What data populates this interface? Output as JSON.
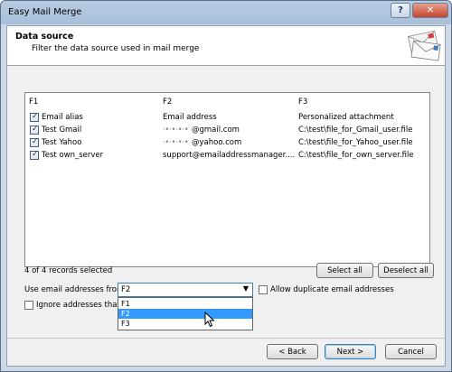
{
  "window": {
    "title": "Easy Mail Merge",
    "help_label": "?",
    "close_label": "✕"
  },
  "header": {
    "title": "Data source",
    "subtitle": "Filter the data source used in mail merge",
    "icon": "envelopes-icon"
  },
  "list": {
    "columns": [
      "F1",
      "F2",
      "F3"
    ],
    "rows": [
      {
        "checked": true,
        "f1": "Email alias",
        "f2_prefix": "",
        "f2": "Email address",
        "f3": "Personalized attachment"
      },
      {
        "checked": true,
        "f1": "Test Gmail",
        "f2_prefix": "·•·•·•·•",
        "f2": "@gmail.com",
        "f3": "C:\\test\\file_for_Gmail_user.file"
      },
      {
        "checked": true,
        "f1": "Test Yahoo",
        "f2_prefix": "·•·•·•·•",
        "f2": "@yahoo.com",
        "f3": "C:\\test\\file_for_Yahoo_user.file"
      },
      {
        "checked": true,
        "f1": "Test own_server",
        "f2_prefix": "",
        "f2": "support@emailaddressmanager....",
        "f3": "C:\\test\\file_for_own_server.file"
      }
    ]
  },
  "status": {
    "records_selected": "4 of 4 records selected"
  },
  "buttons": {
    "select_all": "Select all",
    "deselect_all": "Deselect all",
    "back": "< Back",
    "next": "Next >",
    "cancel": "Cancel"
  },
  "email_source": {
    "label": "Use email addresses from",
    "selected": "F2",
    "options": [
      "F1",
      "F2",
      "F3"
    ],
    "highlighted_option": "F2"
  },
  "allow_duplicates": {
    "label": "Allow duplicate email addresses",
    "checked": false
  },
  "ignore": {
    "label": "Ignore addresses that",
    "checked": false
  },
  "colors": {
    "selection": "#3399ff",
    "title_bar": "#b7cbe2",
    "close_button": "#c3452e"
  }
}
